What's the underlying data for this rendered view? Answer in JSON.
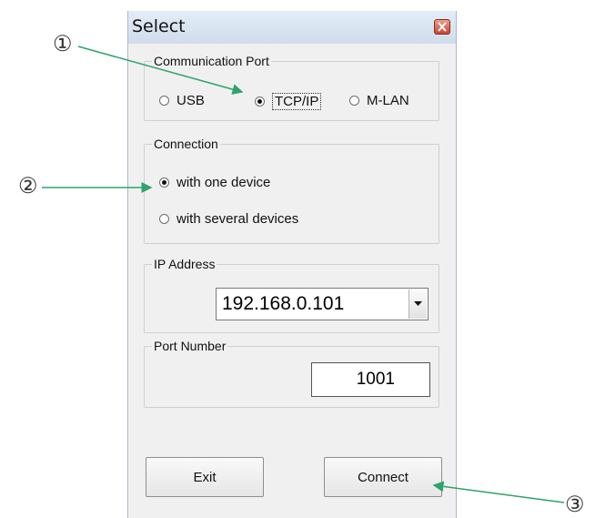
{
  "window": {
    "title": "Select"
  },
  "communication_port": {
    "legend": "Communication Port",
    "options": [
      {
        "label": "USB",
        "selected": false
      },
      {
        "label": "TCP/IP",
        "selected": true
      },
      {
        "label": "M-LAN",
        "selected": false
      }
    ]
  },
  "connection": {
    "legend": "Connection",
    "options": [
      {
        "label": "with one device",
        "selected": true
      },
      {
        "label": "with several devices",
        "selected": false
      }
    ]
  },
  "ip_address": {
    "legend": "IP Address",
    "value": "192.168.0.101"
  },
  "port_number": {
    "legend": "Port Number",
    "value": "1001"
  },
  "buttons": {
    "exit": "Exit",
    "connect": "Connect"
  },
  "callouts": [
    "①",
    "②",
    "③"
  ],
  "colors": {
    "arrow": "#2ea36b",
    "close_button": "#c8462f"
  }
}
